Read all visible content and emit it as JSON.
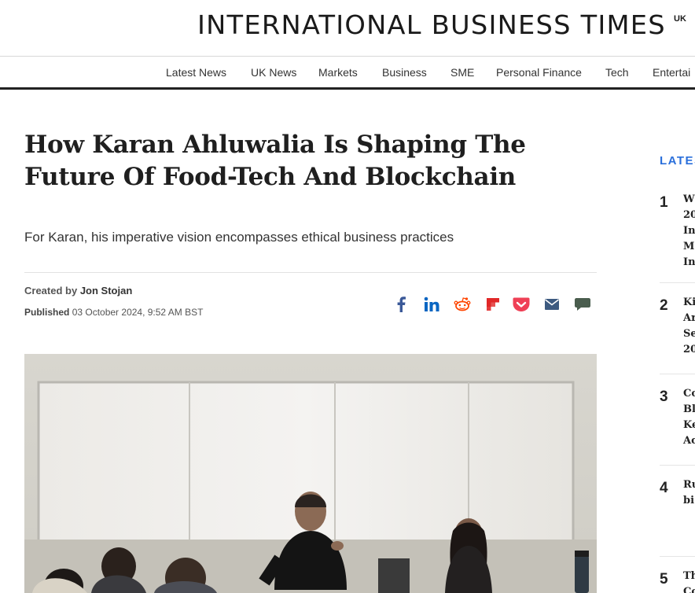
{
  "masthead": {
    "logo_text": "INTERNATIONAL BUSINESS TIMES",
    "edition": "UK"
  },
  "nav": {
    "items": [
      {
        "label": "Latest News"
      },
      {
        "label": "UK News"
      },
      {
        "label": "Markets"
      },
      {
        "label": "Business"
      },
      {
        "label": "SME"
      },
      {
        "label": "Personal Finance"
      },
      {
        "label": "Tech"
      },
      {
        "label": "Entertai"
      }
    ]
  },
  "article": {
    "headline": "How Karan Ahluwalia Is Shaping The Future Of Food-Tech And Blockchain",
    "dek": "For Karan, his imperative vision encompasses ethical business practices",
    "created_label": "Created by",
    "author": "Jon Stojan",
    "published_label": "Published",
    "published_date": "03 October 2024, 9:52 AM BST"
  },
  "share": {
    "icons": [
      "facebook-icon",
      "linkedin-icon",
      "reddit-icon",
      "flipboard-icon",
      "pocket-icon",
      "email-icon",
      "comment-icon"
    ],
    "colors": {
      "facebook": "#3b5998",
      "linkedin": "#0a66c2",
      "reddit": "#ff4500",
      "flipboard": "#e12828",
      "pocket": "#ef4056",
      "email": "#3d5a80",
      "comment": "#4a5d4e"
    }
  },
  "sidebar": {
    "title": "LATES",
    "items": [
      {
        "num": "1",
        "lines": [
          "W",
          "20",
          "In",
          "M",
          "In"
        ]
      },
      {
        "num": "2",
        "lines": [
          "Ki",
          "Ar",
          "Se",
          "20"
        ]
      },
      {
        "num": "3",
        "lines": [
          "Co",
          "Bl",
          "Ke",
          "Ac"
        ]
      },
      {
        "num": "4",
        "lines": [
          "Ru",
          "bi"
        ]
      },
      {
        "num": "5",
        "lines": [
          "Th",
          "Co"
        ]
      }
    ]
  },
  "colors": {
    "accent": "#2a6fdb",
    "text": "#222222"
  }
}
